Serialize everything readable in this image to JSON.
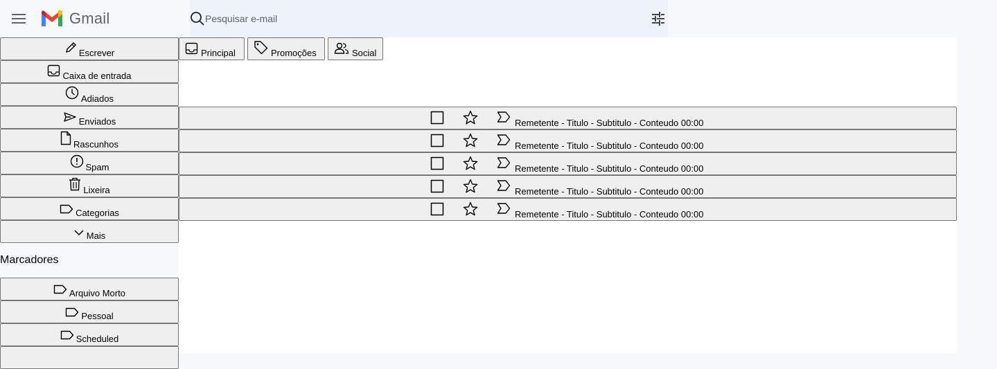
{
  "app": {
    "name": "Gmail"
  },
  "search": {
    "placeholder": "Pesquisar e-mail"
  },
  "sidebar": {
    "items": [
      {
        "label": "Escrever",
        "icon": "pencil-icon"
      },
      {
        "label": "Caixa de entrada",
        "icon": "inbox-icon"
      },
      {
        "label": "Adiados",
        "icon": "clock-icon"
      },
      {
        "label": "Enviados",
        "icon": "send-icon"
      },
      {
        "label": "Rascunhos",
        "icon": "draft-icon"
      },
      {
        "label": "Spam",
        "icon": "spam-icon"
      },
      {
        "label": "Lixeira",
        "icon": "trash-icon"
      },
      {
        "label": "Categorias",
        "icon": "label-icon"
      },
      {
        "label": "Mais",
        "icon": "chevron-down-icon"
      }
    ],
    "labels_title": "Marcadores",
    "labels": [
      {
        "label": "Arquivo Morto",
        "icon": "label-icon"
      },
      {
        "label": "Pessoal",
        "icon": "label-icon"
      },
      {
        "label": "Scheduled",
        "icon": "label-icon"
      }
    ]
  },
  "tabs": [
    {
      "label": "Principal",
      "icon": "inbox-icon"
    },
    {
      "label": "Promoções",
      "icon": "tag-icon"
    },
    {
      "label": "Social",
      "icon": "people-icon"
    }
  ],
  "emails": [
    {
      "text": "Remetente - Titulo - Subtitulo - Conteudo 00:00"
    },
    {
      "text": "Remetente - Titulo - Subtitulo - Conteudo 00:00"
    },
    {
      "text": "Remetente - Titulo - Subtitulo - Conteudo 00:00"
    },
    {
      "text": "Remetente - Titulo - Subtitulo - Conteudo 00:00"
    },
    {
      "text": "Remetente - Titulo - Subtitulo - Conteudo 00:00"
    }
  ],
  "colors": {
    "background": "#f6f8fc",
    "search_bg": "#eef2fb",
    "button_bg": "#efefef",
    "button_border": "#767676",
    "gmail_red": "#ea4335",
    "gmail_blue": "#4285f4",
    "gmail_green": "#34a853",
    "gmail_yellow": "#fbbc04"
  }
}
